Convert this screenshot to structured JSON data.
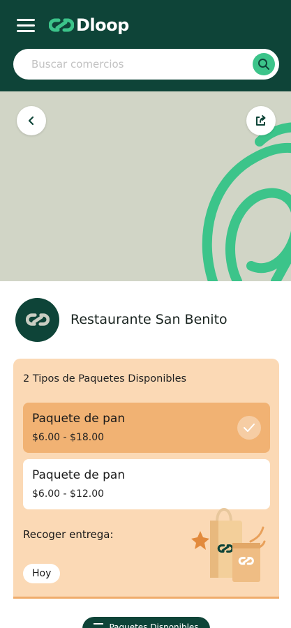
{
  "app": {
    "name": "Dloop"
  },
  "search": {
    "placeholder": "Buscar comercios"
  },
  "store": {
    "name": "Restaurante San Benito"
  },
  "packages": {
    "title": "2 Tipos de Paquetes Disponibles",
    "items": [
      {
        "name": "Paquete de pan",
        "price": "$6.00 - $18.00",
        "selected": true
      },
      {
        "name": "Paquete de pan",
        "price": "$6.00 - $12.00",
        "selected": false
      }
    ],
    "pickup_label": "Recoger entrega:",
    "pickup_day": "Hoy"
  },
  "bottom_button": {
    "label": "Paquetes Disponibles"
  },
  "colors": {
    "header": "#0e4438",
    "accent": "#3cc48a",
    "banner": "#d1d5c6",
    "panel": "#fbd9b5",
    "selected": "#f1b273"
  },
  "icons": {
    "menu": "hamburger-menu-icon",
    "search": "search-icon",
    "back": "chevron-left-icon",
    "share": "share-icon",
    "check": "check-icon"
  }
}
